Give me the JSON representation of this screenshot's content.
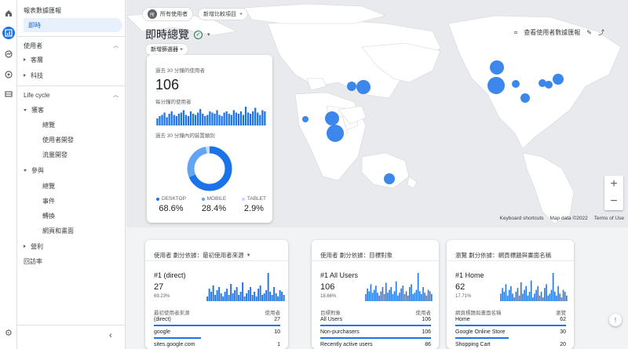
{
  "sidebar": {
    "reports_snapshot": "報表數據匯報",
    "realtime": "即時",
    "section_user": "使用者",
    "user_items": [
      "客層",
      "科技"
    ],
    "section_lifecycle": "Life cycle",
    "acquisition": "獲客",
    "acquisition_items": [
      "總覽",
      "使用者開發",
      "流量開發"
    ],
    "engagement": "參與",
    "engagement_items": [
      "總覽",
      "事件",
      "轉換",
      "網頁和畫面"
    ],
    "monetization": "營利",
    "retention": "回訪率"
  },
  "header": {
    "audience_chip": "所有使用者",
    "audience_avatar": "所",
    "add_comparison": "新增比較項目",
    "title": "即時總覽",
    "add_filter": "新增篩選器",
    "snapshot_label": "查看使用者數據匯報"
  },
  "map": {
    "keyboard_shortcuts": "Keyboard shortcuts",
    "map_data": "Map data ©2022",
    "terms": "Terms of Use",
    "zoom_in": "+",
    "zoom_out": "−"
  },
  "realtime_card": {
    "users_label": "過去 30 分鐘的使用者",
    "users_value": "106",
    "per_minute_label": "每分鐘的使用者",
    "per_minute_bars": [
      6,
      8,
      9,
      11,
      7,
      10,
      12,
      9,
      8,
      10,
      11,
      13,
      9,
      8,
      12,
      10,
      9,
      11,
      14,
      10,
      8,
      9,
      12,
      11,
      10,
      13,
      9,
      8,
      11,
      12,
      10,
      9,
      13,
      11,
      10,
      12,
      9,
      16,
      11,
      10,
      12,
      15,
      11,
      9,
      13,
      12
    ],
    "device_label": "過去 30 分鐘內的裝置類別",
    "devices": [
      {
        "name": "DESKTOP",
        "value": "68.6%",
        "share": 68.6,
        "color": "#1a73e8"
      },
      {
        "name": "MOBILE",
        "value": "28.4%",
        "share": 28.4,
        "color": "#63a4f4"
      },
      {
        "name": "TABLET",
        "value": "2.9%",
        "share": 2.9,
        "color": "#c6dafc"
      }
    ]
  },
  "cards": [
    {
      "head": "使用者 劃分依據：最初使用者來源",
      "has_dropdown": true,
      "rank": "#1  (direct)",
      "value": "27",
      "pct": "69.23%",
      "col1": "最初使用者來源",
      "col2": "使用者",
      "rows": [
        {
          "label": "(direct)",
          "value": "27",
          "share": 1.0
        },
        {
          "label": "google",
          "value": "10",
          "share": 0.37
        },
        {
          "label": "sites.google.com",
          "value": "1",
          "share": 0.04
        }
      ],
      "spark": [
        3,
        8,
        6,
        10,
        4,
        7,
        9,
        5,
        3,
        6,
        8,
        4,
        11,
        5,
        7,
        9,
        4,
        6,
        12,
        3,
        5,
        7,
        9,
        4,
        6,
        3,
        8,
        10,
        4,
        5,
        7,
        18,
        6,
        4,
        9,
        5,
        3,
        7,
        6,
        4
      ]
    },
    {
      "head": "使用者 劃分依據：目標對象",
      "has_dropdown": false,
      "rank": "#1  All Users",
      "value": "106",
      "pct": "18.66%",
      "col1": "目標對象",
      "col2": "使用者",
      "rows": [
        {
          "label": "All Users",
          "value": "106",
          "share": 1.0
        },
        {
          "label": "Non-purchasers",
          "value": "106",
          "share": 1.0
        },
        {
          "label": "Recently active users",
          "value": "86",
          "share": 0.81
        }
      ],
      "spark": [
        5,
        9,
        7,
        12,
        6,
        8,
        11,
        6,
        4,
        7,
        10,
        5,
        13,
        6,
        8,
        10,
        5,
        7,
        14,
        4,
        6,
        9,
        11,
        5,
        7,
        4,
        10,
        12,
        5,
        6,
        8,
        20,
        7,
        5,
        10,
        6,
        4,
        8,
        7,
        5
      ]
    },
    {
      "head": "瀏覽 劃分依據：網頁標題與畫面名稱",
      "has_dropdown": false,
      "rank": "#1  Home",
      "value": "62",
      "pct": "17.71%",
      "col1": "網頁標題與畫面名稱",
      "col2": "瀏覽",
      "rows": [
        {
          "label": "Home",
          "value": "62",
          "share": 1.0
        },
        {
          "label": "Google Online Store",
          "value": "30",
          "share": 0.48
        },
        {
          "label": "Shopping Cart",
          "value": "20",
          "share": 0.32
        }
      ],
      "spark": [
        4,
        7,
        5,
        9,
        3,
        6,
        8,
        4,
        2,
        5,
        7,
        3,
        10,
        4,
        6,
        8,
        3,
        5,
        11,
        2,
        4,
        6,
        8,
        3,
        5,
        2,
        7,
        9,
        3,
        4,
        6,
        15,
        5,
        3,
        8,
        4,
        2,
        6,
        5,
        3
      ]
    }
  ],
  "colors": {
    "accent": "#1a73e8",
    "bubble": "#1a73e8",
    "land": "#ffffff",
    "water": "#e8eaed"
  }
}
